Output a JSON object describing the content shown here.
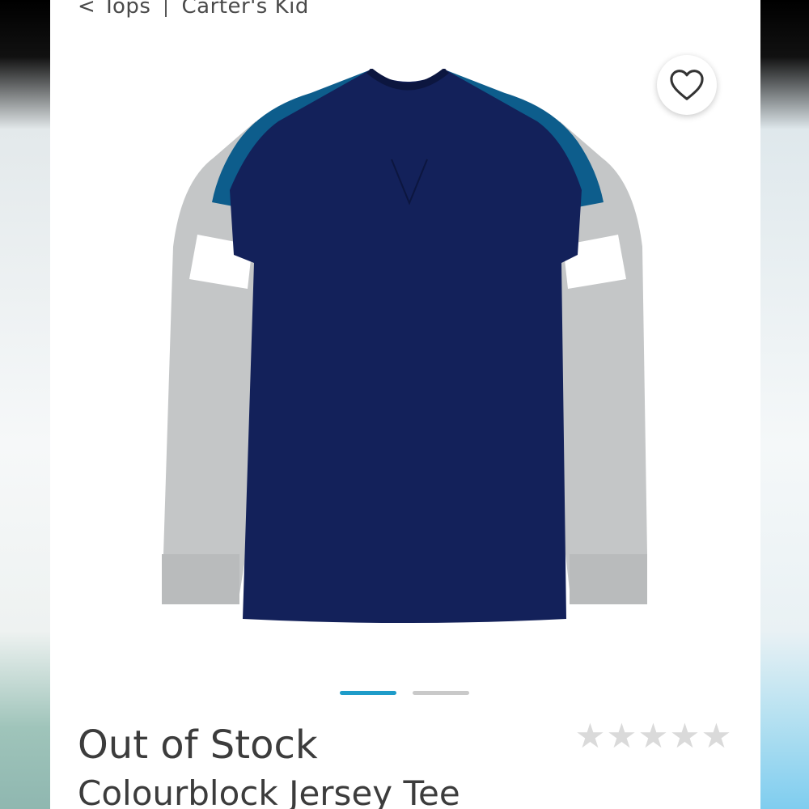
{
  "breadcrumb": {
    "back_label": "< Tops",
    "brand_label": "Carter's  Kid"
  },
  "favorite": {
    "icon": "heart-icon"
  },
  "product_image": {
    "description_icon": "long-sleeve-colourblock-tee",
    "colors": {
      "body": "#13215a",
      "shoulder": "#0d5d8c",
      "sleeve": "#c4c6c7",
      "stripe": "#ffffff"
    }
  },
  "carousel": {
    "total": 2,
    "active_index": 0,
    "active_color": "#1e9cc9"
  },
  "product": {
    "stock_status": "Out of Stock",
    "name": "Colourblock Jersey Tee"
  },
  "rating": {
    "value": 0,
    "max": 5,
    "star_glyph": "★"
  }
}
